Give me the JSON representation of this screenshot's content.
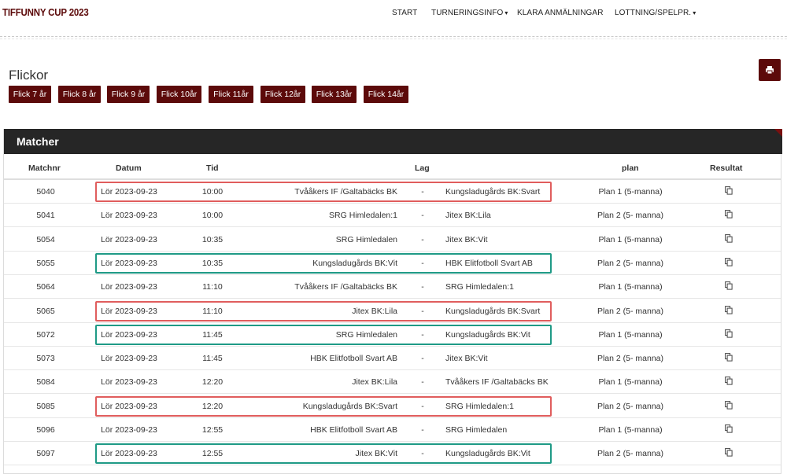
{
  "header": {
    "brand": "TIFFUNNY CUP 2023",
    "nav": [
      {
        "label": "START",
        "caret": ""
      },
      {
        "label": "TURNERINGSINFO",
        "caret": "▾"
      },
      {
        "label": "KLARA ANMÄLNINGAR",
        "caret": ""
      },
      {
        "label": "LOTTNING/SPELPR.",
        "caret": "▾"
      }
    ]
  },
  "section": {
    "title": "Flickor",
    "filters": [
      "Flick 7 år",
      "Flick 8 år",
      "Flick 9 år",
      "Flick 10år",
      "Flick 11år",
      "Flick 12år",
      "Flick 13år",
      "Flick 14år"
    ]
  },
  "panel": {
    "title": "Matcher",
    "columns": {
      "nr": "Matchnr",
      "date": "Datum",
      "tid": "Tid",
      "lag": "Lag",
      "plan": "plan",
      "res": "Resultat"
    }
  },
  "matches": [
    {
      "nr": "5040",
      "date": "Lör 2023-09-23",
      "tid": "10:00",
      "home": "Tvååkers IF /Galtabäcks BK",
      "sep": "-",
      "away": "Kungsladugårds BK:Svart",
      "plan": "Plan 1 (5-manna)",
      "highlight": "red"
    },
    {
      "nr": "5041",
      "date": "Lör 2023-09-23",
      "tid": "10:00",
      "home": "SRG Himledalen:1",
      "sep": "-",
      "away": "Jitex BK:Lila",
      "plan": "Plan 2 (5- manna)",
      "highlight": ""
    },
    {
      "nr": "5054",
      "date": "Lör 2023-09-23",
      "tid": "10:35",
      "home": "SRG Himledalen",
      "sep": "-",
      "away": "Jitex BK:Vit",
      "plan": "Plan 1 (5-manna)",
      "highlight": ""
    },
    {
      "nr": "5055",
      "date": "Lör 2023-09-23",
      "tid": "10:35",
      "home": "Kungsladugårds BK:Vit",
      "sep": "-",
      "away": "HBK Elitfotboll Svart AB",
      "plan": "Plan 2 (5- manna)",
      "highlight": "green"
    },
    {
      "nr": "5064",
      "date": "Lör 2023-09-23",
      "tid": "11:10",
      "home": "Tvååkers IF /Galtabäcks BK",
      "sep": "-",
      "away": "SRG Himledalen:1",
      "plan": "Plan 1 (5-manna)",
      "highlight": ""
    },
    {
      "nr": "5065",
      "date": "Lör 2023-09-23",
      "tid": "11:10",
      "home": "Jitex BK:Lila",
      "sep": "-",
      "away": "Kungsladugårds BK:Svart",
      "plan": "Plan 2 (5- manna)",
      "highlight": "red"
    },
    {
      "nr": "5072",
      "date": "Lör 2023-09-23",
      "tid": "11:45",
      "home": "SRG Himledalen",
      "sep": "-",
      "away": "Kungsladugårds BK:Vit",
      "plan": "Plan 1 (5-manna)",
      "highlight": "green"
    },
    {
      "nr": "5073",
      "date": "Lör 2023-09-23",
      "tid": "11:45",
      "home": "HBK Elitfotboll Svart AB",
      "sep": "-",
      "away": "Jitex BK:Vit",
      "plan": "Plan 2 (5- manna)",
      "highlight": ""
    },
    {
      "nr": "5084",
      "date": "Lör 2023-09-23",
      "tid": "12:20",
      "home": "Jitex BK:Lila",
      "sep": "-",
      "away": "Tvååkers IF /Galtabäcks BK",
      "plan": "Plan 1 (5-manna)",
      "highlight": ""
    },
    {
      "nr": "5085",
      "date": "Lör 2023-09-23",
      "tid": "12:20",
      "home": "Kungsladugårds BK:Svart",
      "sep": "-",
      "away": "SRG Himledalen:1",
      "plan": "Plan 2 (5- manna)",
      "highlight": "red"
    },
    {
      "nr": "5096",
      "date": "Lör 2023-09-23",
      "tid": "12:55",
      "home": "HBK Elitfotboll Svart AB",
      "sep": "-",
      "away": "SRG Himledalen",
      "plan": "Plan 1 (5-manna)",
      "highlight": ""
    },
    {
      "nr": "5097",
      "date": "Lör 2023-09-23",
      "tid": "12:55",
      "home": "Jitex BK:Vit",
      "sep": "-",
      "away": "Kungsladugårds BK:Vit",
      "plan": "Plan 2 (5- manna)",
      "highlight": "green"
    }
  ],
  "icons": {
    "print": "printer-icon",
    "result": "copy-icon"
  },
  "colors": {
    "brand": "#5c0a0a",
    "panel_head": "#262626",
    "highlight_red": "#e05d5d",
    "highlight_green": "#1f9a86"
  }
}
